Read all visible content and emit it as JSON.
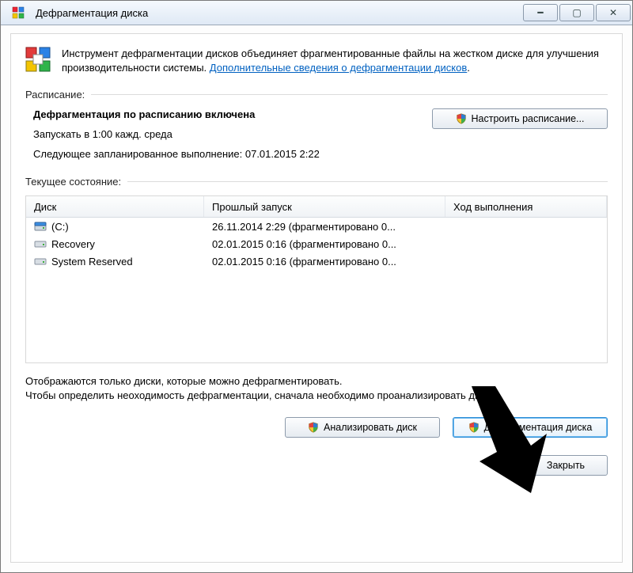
{
  "window": {
    "title": "Дефрагментация диска"
  },
  "intro": {
    "text_before_link": "Инструмент дефрагментации дисков объединяет фрагментированные файлы на жестком диске для улучшения производительности системы. ",
    "link_text": "Дополнительные сведения о дефрагментации дисков",
    "text_after_link": "."
  },
  "sections": {
    "schedule_label": "Расписание:",
    "state_label": "Текущее состояние:"
  },
  "schedule": {
    "status": "Дефрагментация по расписанию включена",
    "run_at": "Запускать в 1:00 кажд. среда",
    "next_run": "Следующее запланированное выполнение: 07.01.2015 2:22",
    "configure_btn": "Настроить расписание..."
  },
  "table": {
    "headers": {
      "disk": "Диск",
      "last": "Прошлый запуск",
      "progress": "Ход выполнения"
    },
    "rows": [
      {
        "name": "(C:)",
        "icon": "drive-c",
        "last": "26.11.2014 2:29 (фрагментировано 0...",
        "progress": ""
      },
      {
        "name": "Recovery",
        "icon": "drive",
        "last": "02.01.2015 0:16 (фрагментировано 0...",
        "progress": ""
      },
      {
        "name": "System Reserved",
        "icon": "drive",
        "last": "02.01.2015 0:16 (фрагментировано 0...",
        "progress": ""
      }
    ]
  },
  "note": {
    "line1": "Отображаются только диски, которые можно дефрагментировать.",
    "line2": "Чтобы определить неоходимость  дефрагментации, сначала необходимо проанализировать диски."
  },
  "buttons": {
    "analyze": "Анализировать диск",
    "defrag": "Дефрагментация диска",
    "close": "Закрыть"
  }
}
